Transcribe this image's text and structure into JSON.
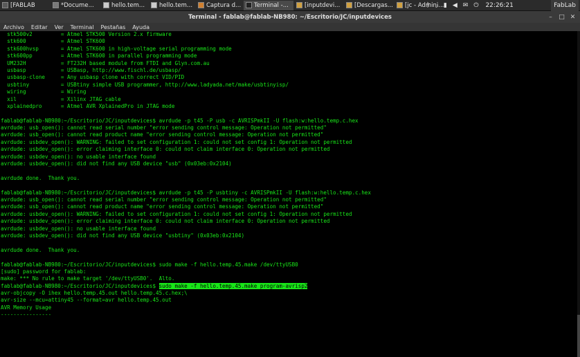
{
  "taskbar": {
    "items": [
      {
        "label": "[FABLAB",
        "icon": "terminal-icon",
        "color": "#5a5a5a",
        "active": false
      },
      {
        "label": "*Docume...",
        "icon": "text-editor-icon",
        "color": "#7a7a7a",
        "active": false
      },
      {
        "label": "hello.tem...",
        "icon": "document-icon",
        "color": "#cccccc",
        "active": false
      },
      {
        "label": "hello.tem...",
        "icon": "document-icon",
        "color": "#cccccc",
        "active": false
      },
      {
        "label": "Captura d...",
        "icon": "image-icon",
        "color": "#d08030",
        "active": false
      },
      {
        "label": "Terminal -...",
        "icon": "terminal-icon",
        "color": "#222222",
        "active": true
      },
      {
        "label": "[inputdevi...",
        "icon": "folder-icon",
        "color": "#d0a040",
        "active": false
      },
      {
        "label": "[Descargas...",
        "icon": "folder-icon",
        "color": "#d0a040",
        "active": false
      },
      {
        "label": "[jc - Admini...",
        "icon": "folder-icon",
        "color": "#d0a040",
        "active": false
      }
    ],
    "clock": "22:26:21",
    "right_label": "FabLab"
  },
  "window": {
    "title": "Terminal - fablab@fablab-NB980: ~/Escritorio/JC/inputdevices"
  },
  "menu": [
    "Archivo",
    "Editar",
    "Ver",
    "Terminal",
    "Pestañas",
    "Ayuda"
  ],
  "terminal": {
    "lines": [
      {
        "text": "  stk500v2         = Atmel STK500 Version 2.x firmware"
      },
      {
        "text": "  stk600           = Atmel STK600"
      },
      {
        "text": "  stk600hvsp       = Atmel STK600 in high-voltage serial programming mode"
      },
      {
        "text": "  stk600pp         = Atmel STK600 in parallel programming mode"
      },
      {
        "text": "  UM232H           = FT232H based module from FTDI and Glyn.com.au"
      },
      {
        "text": "  usbasp           = USBasp, http://www.fischl.de/usbasp/"
      },
      {
        "text": "  usbasp-clone     = Any usbasp clone with correct VID/PID"
      },
      {
        "text": "  usbtiny          = USBtiny simple USB programmer, http://www.ladyada.net/make/usbtinyisp/"
      },
      {
        "text": "  wiring           = Wiring"
      },
      {
        "text": "  xil              = Xilinx JTAG cable"
      },
      {
        "text": "  xplainedpro      = Atmel AVR XplainedPro in JTAG mode"
      },
      {
        "text": ""
      },
      {
        "text": "fablab@fablab-NB980:~/Escritorio/JC/inputdevices$ avrdude -p t45 -P usb -c AVRISPmkII -U flash:w:hello.temp.c.hex"
      },
      {
        "text": "avrdude: usb_open(): cannot read serial number \"error sending control message: Operation not permitted\""
      },
      {
        "text": "avrdude: usb_open(): cannot read product name \"error sending control message: Operation not permitted\""
      },
      {
        "text": "avrdude: usbdev_open(): WARNING: failed to set configuration 1: could not set config 1: Operation not permitted"
      },
      {
        "text": "avrdude: usbdev_open(): error claiming interface 0: could not claim interface 0: Operation not permitted"
      },
      {
        "text": "avrdude: usbdev_open(): no usable interface found"
      },
      {
        "text": "avrdude: usbdev_open(): did not find any USB device \"usb\" (0x03eb:0x2104)"
      },
      {
        "text": ""
      },
      {
        "text": "avrdude done.  Thank you."
      },
      {
        "text": ""
      },
      {
        "text": "fablab@fablab-NB980:~/Escritorio/JC/inputdevices$ avrdude -p t45 -P usbtiny -c AVRISPmkII -U flash:w:hello.temp.c.hex"
      },
      {
        "text": "avrdude: usb_open(): cannot read serial number \"error sending control message: Operation not permitted\""
      },
      {
        "text": "avrdude: usb_open(): cannot read product name \"error sending control message: Operation not permitted\""
      },
      {
        "text": "avrdude: usbdev_open(): WARNING: failed to set configuration 1: could not set config 1: Operation not permitted"
      },
      {
        "text": "avrdude: usbdev_open(): error claiming interface 0: could not claim interface 0: Operation not permitted"
      },
      {
        "text": "avrdude: usbdev_open(): no usable interface found"
      },
      {
        "text": "avrdude: usbdev_open(): did not find any USB device \"usbtiny\" (0x03eb:0x2104)"
      },
      {
        "text": ""
      },
      {
        "text": "avrdude done.  Thank you."
      },
      {
        "text": ""
      },
      {
        "text": "fablab@fablab-NB980:~/Escritorio/JC/inputdevices$ sudo make -f hello.temp.45.make /dev/ttyUSB0"
      },
      {
        "text": "[sudo] password for fablab:"
      },
      {
        "text": "make: *** No rule to make target '/dev/ttyUSB0'.  Alto."
      },
      {
        "text": "fablab@fablab-NB980:~/Escritorio/JC/inputdevices$ ",
        "highlight": "sudo make -f hello.temp.45.make program-avrisp2"
      },
      {
        "text": "avr-objcopy -O ihex hello.temp.45.out hello.temp.45.c.hex;\\"
      },
      {
        "text": "avr-size --mcu=attiny45 --format=avr hello.temp.45.out"
      },
      {
        "text": "AVR Memory Usage"
      },
      {
        "text": "----------------"
      }
    ],
    "text_color": "#19e619",
    "background": "#000000"
  }
}
